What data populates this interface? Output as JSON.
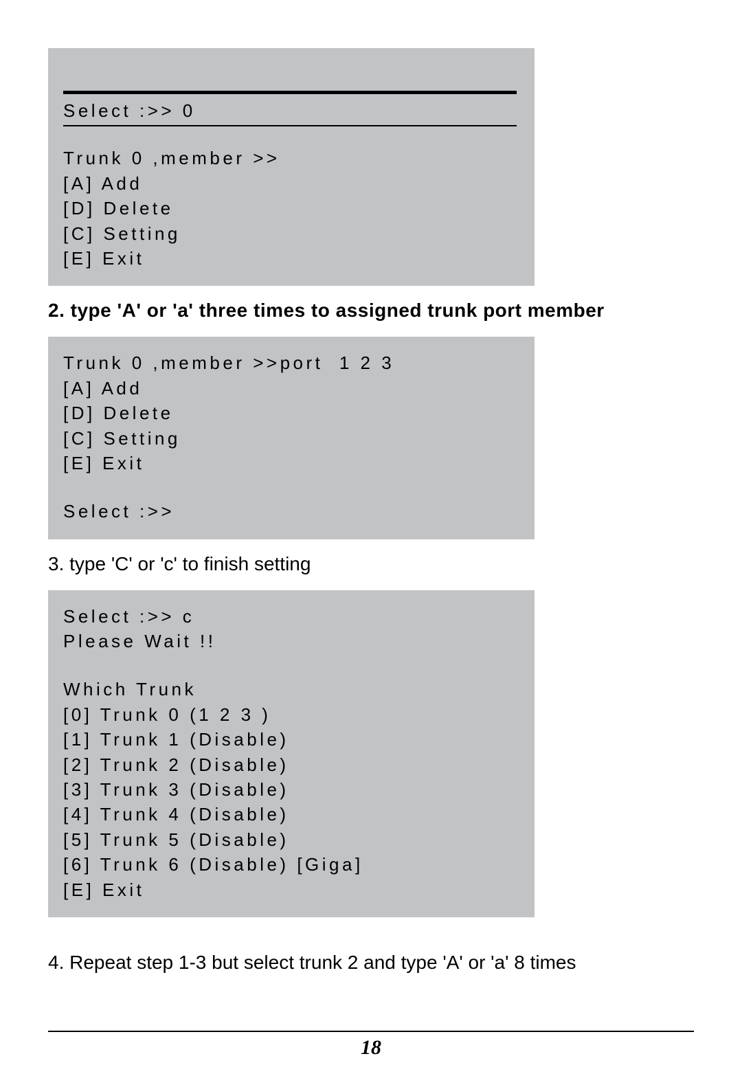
{
  "box1": {
    "select": "Select :>> 0",
    "line1": "Trunk 0 ,member >>",
    "a": "[A] Add",
    "d": "[D] Delete",
    "c": "[C] Setting",
    "e": "[E] Exit"
  },
  "step2": "2. type 'A' or 'a' three times to assigned trunk port member",
  "box2": {
    "line1": "Trunk 0 ,member >>port  1 2 3",
    "a": "[A] Add",
    "d": "[D] Delete",
    "c": "[C] Setting",
    "e": "[E] Exit",
    "select": "Select :>>"
  },
  "step3": "3. type 'C' or 'c' to finish setting",
  "box3": {
    "select": "Select :>> c",
    "wait": "Please Wait !!",
    "which": "Which Trunk",
    "t0": "[0] Trunk 0 (1 2 3 )",
    "t1": "[1] Trunk 1 (Disable)",
    "t2": "[2] Trunk 2 (Disable)",
    "t3": "[3] Trunk 3 (Disable)",
    "t4": "[4] Trunk 4 (Disable)",
    "t5": "[5] Trunk 5 (Disable)",
    "t6": "[6] Trunk 6 (Disable) [Giga]",
    "e": "[E] Exit"
  },
  "step4": "4. Repeat step 1-3 but select trunk 2 and type 'A' or 'a' 8 times",
  "page_number": "18"
}
